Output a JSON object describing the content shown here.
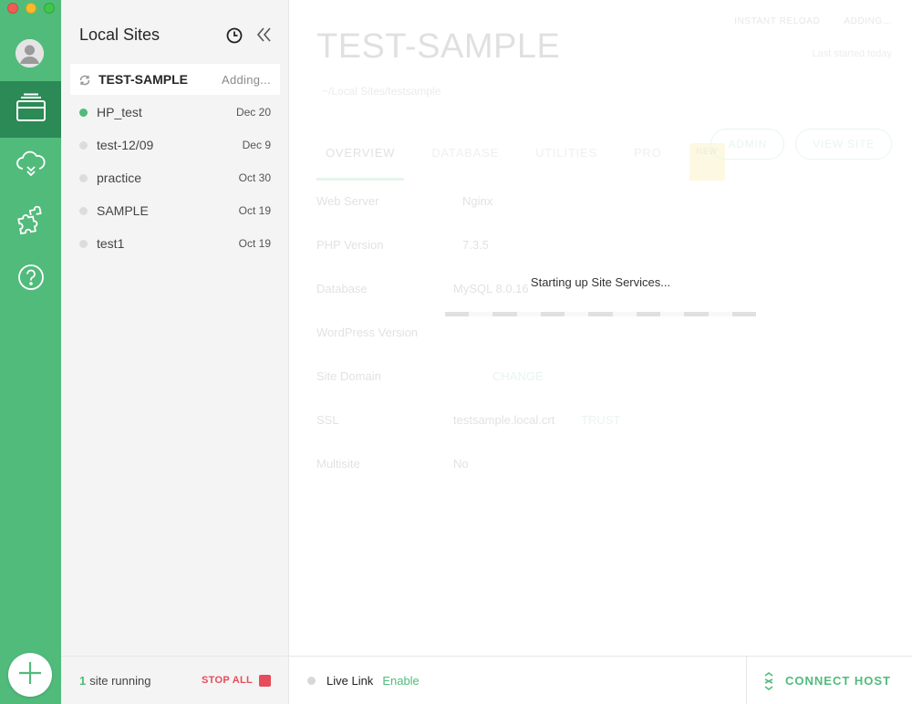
{
  "colors": {
    "accent": "#51bb7b",
    "accent_dark": "#2b8a55",
    "danger": "#e74c5a"
  },
  "sidebar": {
    "title": "Local Sites",
    "sites": [
      {
        "name": "TEST-SAMPLE",
        "meta": "Adding...",
        "state": "adding",
        "selected": true
      },
      {
        "name": "HP_test",
        "meta": "Dec 20",
        "state": "running"
      },
      {
        "name": "test-12/09",
        "meta": "Dec 9",
        "state": "stopped"
      },
      {
        "name": "practice",
        "meta": "Oct 30",
        "state": "stopped"
      },
      {
        "name": "SAMPLE",
        "meta": "Oct 19",
        "state": "stopped"
      },
      {
        "name": "test1",
        "meta": "Oct 19",
        "state": "stopped"
      }
    ],
    "footer": {
      "running_count": "1",
      "running_text": "site running",
      "stop_all": "STOP ALL"
    }
  },
  "site": {
    "title": "TEST-SAMPLE",
    "path": "~/Local Sites/testsample",
    "instant_reload": "INSTANT RELOAD",
    "adding": "ADDING...",
    "last_started": "Last started today",
    "tabs": [
      "OVERVIEW",
      "DATABASE",
      "UTILITIES",
      "PRO"
    ],
    "new_badge": "NEW",
    "admin_button": "ADMIN",
    "view_site_button": "VIEW SITE",
    "fields": [
      {
        "label": "Web Server",
        "value": "Nginx"
      },
      {
        "label": "PHP Version",
        "value": "7.3.5"
      },
      {
        "label": "Database",
        "value": "MySQL 8.0.16"
      },
      {
        "label": "WordPress Version",
        "value": ""
      },
      {
        "label": "Site Domain",
        "value": "CHANGE"
      },
      {
        "label": "SSL",
        "value": "testsample.local.crt",
        "action": "TRUST"
      },
      {
        "label": "Multisite",
        "value": "No"
      }
    ]
  },
  "overlay": {
    "message": "Starting up Site Services..."
  },
  "footer": {
    "live_link_label": "Live Link",
    "live_link_action": "Enable",
    "connect_host": "CONNECT HOST"
  },
  "icons": [
    "user-avatar-icon",
    "sites-icon",
    "cloud-icon",
    "puzzle-icon",
    "help-icon",
    "plus-icon",
    "history-icon",
    "collapse-icon",
    "spinner-icon",
    "connect-host-icon"
  ]
}
